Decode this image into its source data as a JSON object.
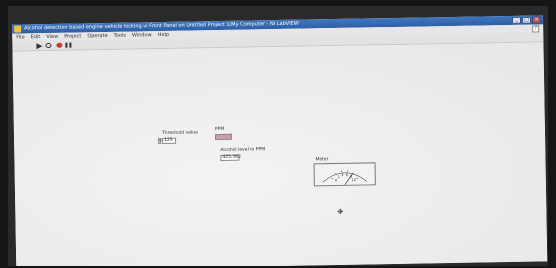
{
  "window": {
    "title": "Alcohol detection based engine vehicle locking.vi Front Panel on Untitled Project 1/My Computer - NI LabVIEW",
    "buttons": [
      "_",
      "□",
      "×"
    ]
  },
  "menu": {
    "items": [
      "File",
      "Edit",
      "View",
      "Project",
      "Operate",
      "Tools",
      "Window",
      "Help"
    ]
  },
  "help_icon_glyph": "?",
  "toolbar": {
    "icons": [
      "run-arrow-icon",
      "run-continuously-icon",
      "abort-icon",
      "pause-icon"
    ]
  },
  "controls": {
    "threshold_label": "Threshold value",
    "threshold_value": "125",
    "ppm_label": "PPM",
    "ppm_value": "",
    "alcohol_label": "Alcohol level in PPM",
    "alcohol_value": "425.362"
  },
  "meter": {
    "label": "Meter",
    "scale": [
      "0",
      "2",
      "4",
      "6",
      "8",
      "10"
    ],
    "value": 7.8
  },
  "colors": {
    "title_bar": "#3f78c0",
    "ppm_indicator": "#c8a0aa"
  }
}
